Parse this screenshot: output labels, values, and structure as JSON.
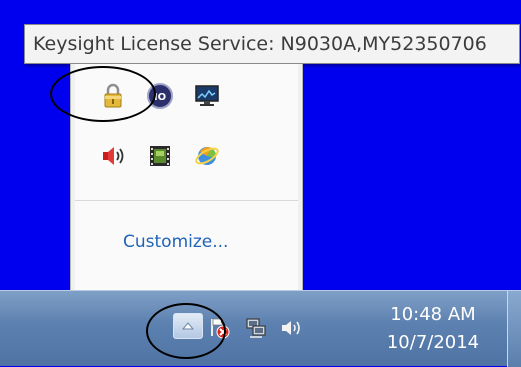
{
  "tooltip": {
    "text": "Keysight License Service: N9030A,MY52350706"
  },
  "tray_popup": {
    "icons": [
      "lock-icon",
      "io-icon",
      "network-monitor-icon",
      "speaker-icon",
      "film-icon",
      "colorful-app-icon"
    ],
    "customize_label": "Customize..."
  },
  "taskbar": {
    "show_hidden_icon": "triangle-up-icon",
    "tray_icons": [
      "disconnected-flag-icon",
      "network-icon",
      "volume-icon"
    ],
    "clock_time": "10:48 AM",
    "clock_date": "10/7/2014"
  },
  "colors": {
    "desktop": "#0000ee",
    "link": "#1f63b8",
    "taskbar": "#5c80af"
  }
}
